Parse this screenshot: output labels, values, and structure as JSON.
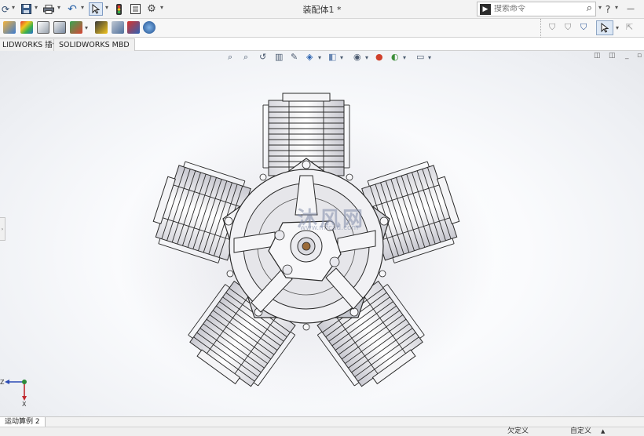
{
  "app": {
    "doc_title": "装配体1 *"
  },
  "title_icons": [
    {
      "name": "open-icon",
      "glyph": "⟳"
    },
    {
      "name": "save-icon",
      "glyph": "💾"
    },
    {
      "name": "print-icon",
      "glyph": "⎙"
    },
    {
      "name": "undo-icon",
      "glyph": "↶"
    },
    {
      "name": "select-arrow-icon",
      "glyph": "⇱"
    },
    {
      "name": "traffic-light-icon",
      "glyph": "⦿"
    },
    {
      "name": "file-properties-icon",
      "glyph": "☷"
    },
    {
      "name": "options-gear-icon",
      "glyph": "⚙"
    }
  ],
  "search": {
    "placeholder": "搜索命令",
    "help": "?",
    "minimize": "—"
  },
  "tabs": [
    {
      "label": "LIDWORKS 插件"
    },
    {
      "label": "SOLIDWORKS MBD"
    }
  ],
  "motion": {
    "tab_label": "运动算例 2"
  },
  "status": {
    "under_defined": "欠定义",
    "custom": "自定义"
  },
  "colors": {
    "accent": "#1d6fbf",
    "titlebar": "#f3f3f3",
    "model_line": "#2a2a2a"
  }
}
